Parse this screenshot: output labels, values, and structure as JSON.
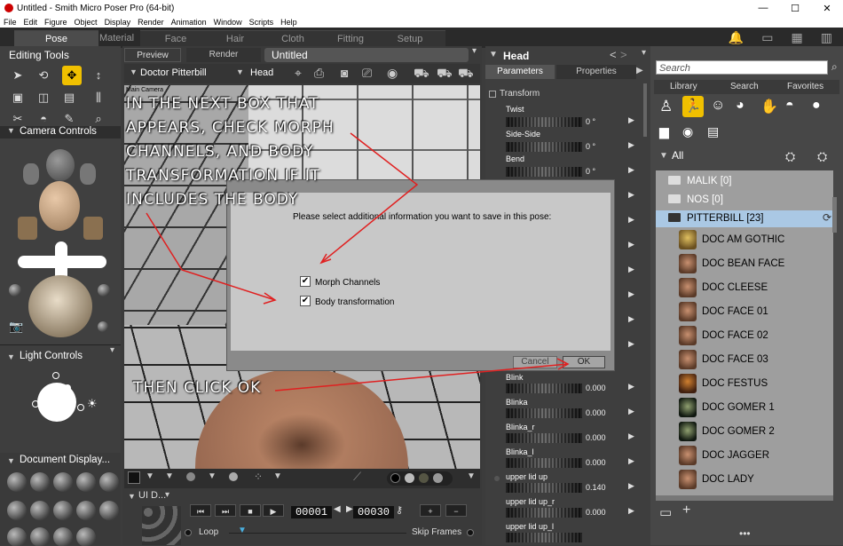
{
  "window": {
    "title": "Untitled - Smith Micro Poser Pro  (64-bit)",
    "min": "—",
    "max": "☐",
    "close": "✕"
  },
  "menu": [
    "File",
    "Edit",
    "Figure",
    "Object",
    "Display",
    "Render",
    "Animation",
    "Window",
    "Scripts",
    "Help"
  ],
  "rooms": [
    "Pose",
    "Material",
    "Face",
    "Hair",
    "Cloth",
    "Fitting",
    "Setup"
  ],
  "left": {
    "editing_tools": "Editing Tools",
    "camera_controls": "Camera Controls",
    "light_controls": "Light Controls",
    "document_display": "Document Display...",
    "ui_dots": "UI D..."
  },
  "viewport": {
    "tabs": [
      "Preview",
      "Render"
    ],
    "doc_title": "Untitled",
    "figure": "Doctor Pitterbill",
    "part": "Head",
    "camera": "Main Camera"
  },
  "timeline": {
    "frame": "00001",
    "total": "00030",
    "loop": "Loop",
    "skip": "Skip Frames"
  },
  "params": {
    "actor": "Head",
    "tabs": [
      "Parameters",
      "Properties"
    ],
    "group": "Transform",
    "rows": [
      {
        "label": "Twist",
        "value": "0 °"
      },
      {
        "label": "Side-Side",
        "value": "0 °"
      },
      {
        "label": "Bend",
        "value": "0 °"
      },
      {
        "label": "Blink",
        "value": "0.000"
      },
      {
        "label": "Blinka",
        "value": "0.000"
      },
      {
        "label": "Blinka_r",
        "value": "0.000"
      },
      {
        "label": "Blinka_l",
        "value": "0.000"
      },
      {
        "label": "upper lid up",
        "value": "0.140"
      },
      {
        "label": "upper lid up_r",
        "value": "0.000"
      },
      {
        "label": "upper lid up_l",
        "value": ""
      }
    ]
  },
  "library": {
    "search_placeholder": "Search",
    "tabs": [
      "Library",
      "Search",
      "Favorites"
    ],
    "root": "All",
    "folders": [
      {
        "name": "MALIK [0]"
      },
      {
        "name": "NOS [0]"
      },
      {
        "name": "PITTERBILL [23]"
      }
    ],
    "items": [
      "DOC AM GOTHIC",
      "DOC BEAN FACE",
      "DOC CLEESE",
      "DOC FACE 01",
      "DOC FACE 02",
      "DOC FACE 03",
      "DOC FESTUS",
      "DOC GOMER 1",
      "DOC GOMER 2",
      "DOC JAGGER",
      "DOC LADY"
    ]
  },
  "dialog": {
    "message": "Please select additional information you want to save in this pose:",
    "options": [
      {
        "label": "Morph Channels",
        "checked": true
      },
      {
        "label": "Body transformation",
        "checked": true
      }
    ],
    "cancel": "Cancel",
    "ok": "OK"
  },
  "annotations": {
    "line1": "IN THE NEXT BOX THAT",
    "line2": "APPEARS, CHECK MORPH",
    "line3": "CHANNELS, AND BODY",
    "line4": "TRANSFORMATION IF IT",
    "line5": "INCLUDES THE BODY",
    "click_ok": "THEN CLICK OK"
  },
  "colors": {
    "accent": "#f0c000",
    "selected_folder": "#aac8e4",
    "arrow": "#e02020"
  }
}
